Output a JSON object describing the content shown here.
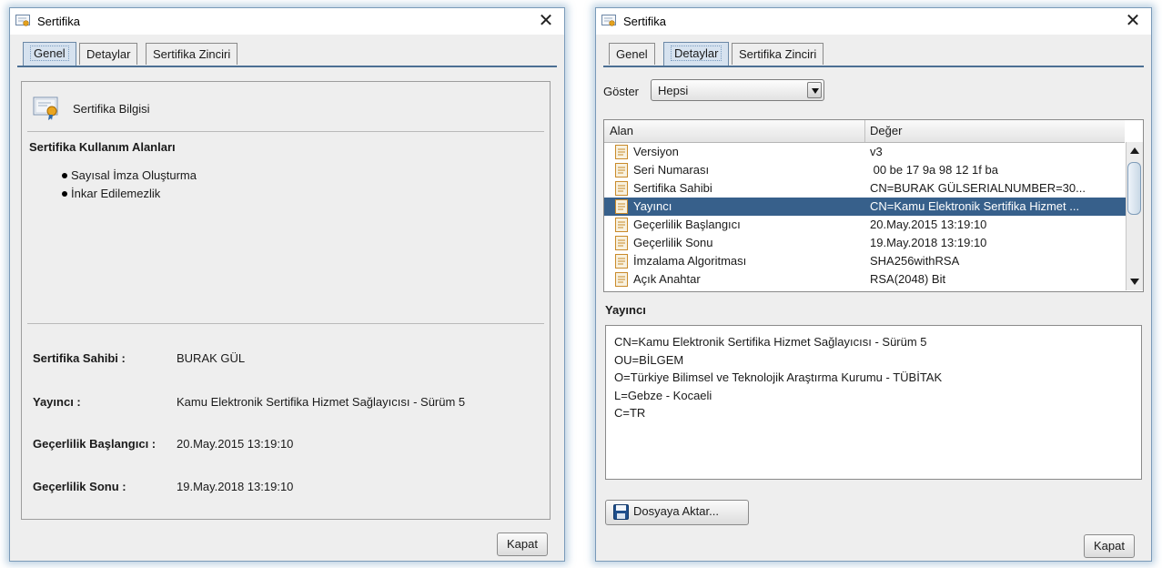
{
  "left_window": {
    "title": "Sertifika",
    "tabs": [
      "Genel",
      "Detaylar",
      "Sertifika Zinciri"
    ],
    "active_tab": "Genel",
    "info_title": "Sertifika Bilgisi",
    "usage_title": "Sertifika Kullanım Alanları",
    "usages": [
      "Sayısal İmza Oluşturma",
      "İnkar Edilemezlik"
    ],
    "fields": [
      {
        "label": "Sertifika Sahibi :",
        "value": "BURAK GÜL"
      },
      {
        "label": "Yayıncı :",
        "value": "Kamu Elektronik Sertifika Hizmet Sağlayıcısı - Sürüm 5"
      },
      {
        "label": "Geçerlilik Başlangıcı :",
        "value": "20.May.2015 13:19:10"
      },
      {
        "label": "Geçerlilik Sonu :",
        "value": "19.May.2018 13:19:10"
      }
    ],
    "close_button": "Kapat"
  },
  "right_window": {
    "title": "Sertifika",
    "tabs": [
      "Genel",
      "Detaylar",
      "Sertifika Zinciri"
    ],
    "active_tab": "Detaylar",
    "show_label": "Göster",
    "show_value": "Hepsi",
    "columns": [
      "Alan",
      "Değer"
    ],
    "rows": [
      {
        "field": "Versiyon",
        "value": "v3"
      },
      {
        "field": "Seri Numarası",
        "value": " 00 be 17 9a 98 12 1f ba"
      },
      {
        "field": "Sertifika Sahibi",
        "value": "CN=BURAK GÜLSERIALNUMBER=30..."
      },
      {
        "field": "Yayıncı",
        "value": "CN=Kamu Elektronik Sertifika Hizmet ..."
      },
      {
        "field": "Geçerlilik Başlangıcı",
        "value": "20.May.2015 13:19:10"
      },
      {
        "field": "Geçerlilik Sonu",
        "value": "19.May.2018 13:19:10"
      },
      {
        "field": "İmzalama Algoritması",
        "value": "SHA256withRSA"
      },
      {
        "field": "Açık Anahtar",
        "value": "RSA(2048) Bit"
      }
    ],
    "selected_row": 3,
    "detail_title": "Yayıncı",
    "detail_lines": [
      "CN=Kamu Elektronik Sertifika Hizmet Sağlayıcısı - Sürüm 5",
      "OU=BİLGEM",
      "O=Türkiye Bilimsel ve Teknolojik Araştırma Kurumu - TÜBİTAK",
      "L=Gebze - Kocaeli",
      "C=TR"
    ],
    "export_button": "Dosyaya Aktar...",
    "close_button": "Kapat"
  },
  "colors": {
    "selection": "#37608b",
    "active_tab": "#d6e2ef",
    "tab_line": "#4b6f93"
  },
  "icons": {
    "title": "certificate-icon",
    "row": "document-icon",
    "export": "floppy-disk-icon",
    "close": "close-icon"
  }
}
